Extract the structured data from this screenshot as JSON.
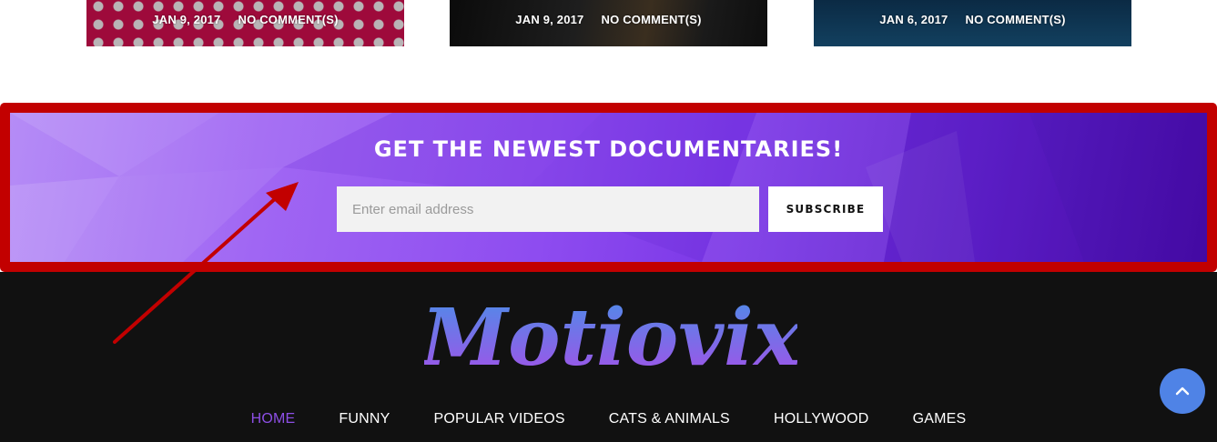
{
  "posts": [
    {
      "date": "JAN 9, 2017",
      "comments": "NO COMMENT(S)"
    },
    {
      "date": "JAN 9, 2017",
      "comments": "NO COMMENT(S)"
    },
    {
      "date": "JAN 6, 2017",
      "comments": "NO COMMENT(S)"
    }
  ],
  "newsletter": {
    "title": "GET THE NEWEST DOCUMENTARIES!",
    "email_placeholder": "Enter email address",
    "subscribe_label": "SUBSCRIBE"
  },
  "footer": {
    "logo_text": "Motiovix",
    "nav": [
      "HOME",
      "FUNNY",
      "POPULAR VIDEOS",
      "CATS & ANIMALS",
      "HOLLYWOOD",
      "GAMES"
    ]
  },
  "icons": {
    "back_to_top": "chevron-up-icon",
    "annotation": "red-arrow-annotation"
  },
  "colors": {
    "accent_purple": "#8d4fe6",
    "annotation_red": "#c20000",
    "back_to_top_blue": "#4f83e6",
    "footer_bg": "#111111"
  }
}
